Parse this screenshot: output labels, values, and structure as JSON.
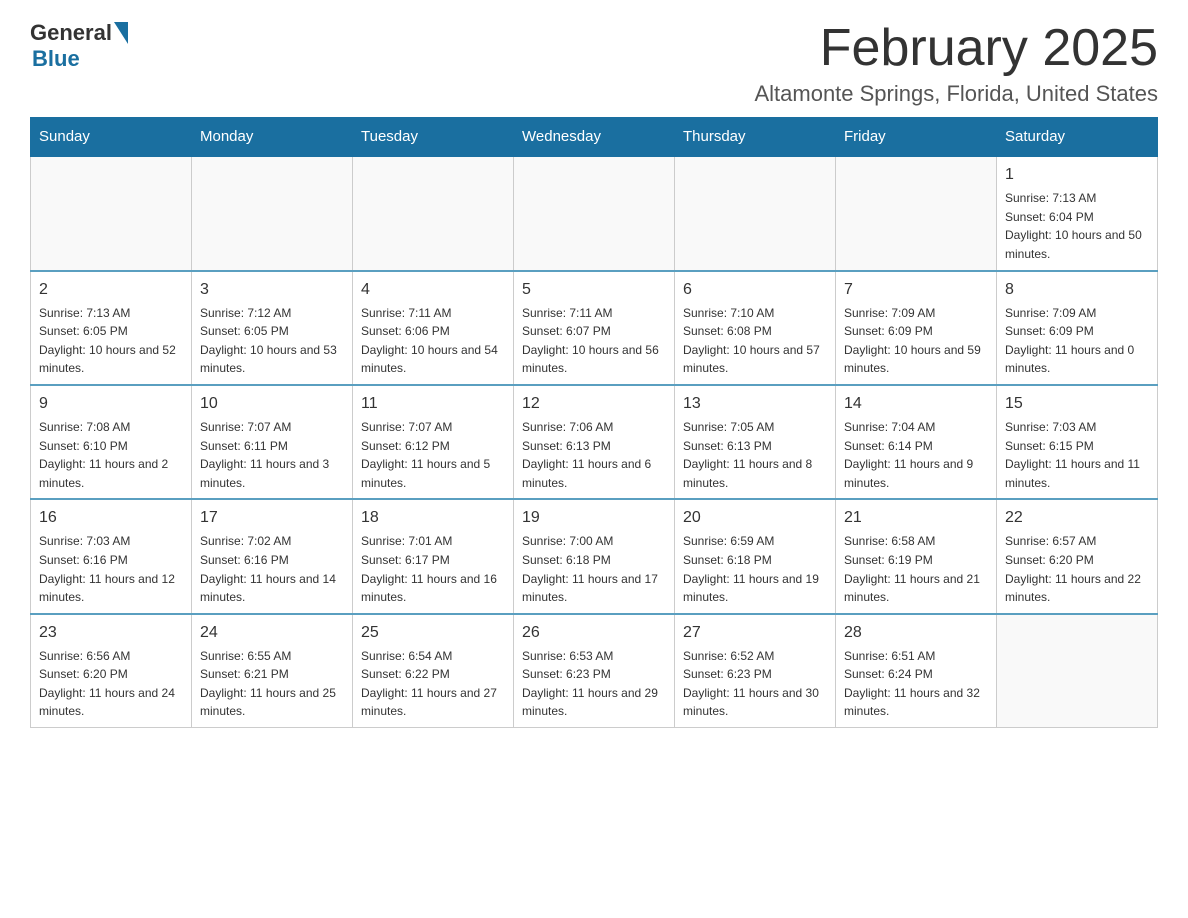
{
  "header": {
    "logo_general": "General",
    "logo_blue": "Blue",
    "month_title": "February 2025",
    "location": "Altamonte Springs, Florida, United States"
  },
  "weekdays": [
    "Sunday",
    "Monday",
    "Tuesday",
    "Wednesday",
    "Thursday",
    "Friday",
    "Saturday"
  ],
  "weeks": [
    [
      {
        "day": "",
        "sunrise": "",
        "sunset": "",
        "daylight": ""
      },
      {
        "day": "",
        "sunrise": "",
        "sunset": "",
        "daylight": ""
      },
      {
        "day": "",
        "sunrise": "",
        "sunset": "",
        "daylight": ""
      },
      {
        "day": "",
        "sunrise": "",
        "sunset": "",
        "daylight": ""
      },
      {
        "day": "",
        "sunrise": "",
        "sunset": "",
        "daylight": ""
      },
      {
        "day": "",
        "sunrise": "",
        "sunset": "",
        "daylight": ""
      },
      {
        "day": "1",
        "sunrise": "Sunrise: 7:13 AM",
        "sunset": "Sunset: 6:04 PM",
        "daylight": "Daylight: 10 hours and 50 minutes."
      }
    ],
    [
      {
        "day": "2",
        "sunrise": "Sunrise: 7:13 AM",
        "sunset": "Sunset: 6:05 PM",
        "daylight": "Daylight: 10 hours and 52 minutes."
      },
      {
        "day": "3",
        "sunrise": "Sunrise: 7:12 AM",
        "sunset": "Sunset: 6:05 PM",
        "daylight": "Daylight: 10 hours and 53 minutes."
      },
      {
        "day": "4",
        "sunrise": "Sunrise: 7:11 AM",
        "sunset": "Sunset: 6:06 PM",
        "daylight": "Daylight: 10 hours and 54 minutes."
      },
      {
        "day": "5",
        "sunrise": "Sunrise: 7:11 AM",
        "sunset": "Sunset: 6:07 PM",
        "daylight": "Daylight: 10 hours and 56 minutes."
      },
      {
        "day": "6",
        "sunrise": "Sunrise: 7:10 AM",
        "sunset": "Sunset: 6:08 PM",
        "daylight": "Daylight: 10 hours and 57 minutes."
      },
      {
        "day": "7",
        "sunrise": "Sunrise: 7:09 AM",
        "sunset": "Sunset: 6:09 PM",
        "daylight": "Daylight: 10 hours and 59 minutes."
      },
      {
        "day": "8",
        "sunrise": "Sunrise: 7:09 AM",
        "sunset": "Sunset: 6:09 PM",
        "daylight": "Daylight: 11 hours and 0 minutes."
      }
    ],
    [
      {
        "day": "9",
        "sunrise": "Sunrise: 7:08 AM",
        "sunset": "Sunset: 6:10 PM",
        "daylight": "Daylight: 11 hours and 2 minutes."
      },
      {
        "day": "10",
        "sunrise": "Sunrise: 7:07 AM",
        "sunset": "Sunset: 6:11 PM",
        "daylight": "Daylight: 11 hours and 3 minutes."
      },
      {
        "day": "11",
        "sunrise": "Sunrise: 7:07 AM",
        "sunset": "Sunset: 6:12 PM",
        "daylight": "Daylight: 11 hours and 5 minutes."
      },
      {
        "day": "12",
        "sunrise": "Sunrise: 7:06 AM",
        "sunset": "Sunset: 6:13 PM",
        "daylight": "Daylight: 11 hours and 6 minutes."
      },
      {
        "day": "13",
        "sunrise": "Sunrise: 7:05 AM",
        "sunset": "Sunset: 6:13 PM",
        "daylight": "Daylight: 11 hours and 8 minutes."
      },
      {
        "day": "14",
        "sunrise": "Sunrise: 7:04 AM",
        "sunset": "Sunset: 6:14 PM",
        "daylight": "Daylight: 11 hours and 9 minutes."
      },
      {
        "day": "15",
        "sunrise": "Sunrise: 7:03 AM",
        "sunset": "Sunset: 6:15 PM",
        "daylight": "Daylight: 11 hours and 11 minutes."
      }
    ],
    [
      {
        "day": "16",
        "sunrise": "Sunrise: 7:03 AM",
        "sunset": "Sunset: 6:16 PM",
        "daylight": "Daylight: 11 hours and 12 minutes."
      },
      {
        "day": "17",
        "sunrise": "Sunrise: 7:02 AM",
        "sunset": "Sunset: 6:16 PM",
        "daylight": "Daylight: 11 hours and 14 minutes."
      },
      {
        "day": "18",
        "sunrise": "Sunrise: 7:01 AM",
        "sunset": "Sunset: 6:17 PM",
        "daylight": "Daylight: 11 hours and 16 minutes."
      },
      {
        "day": "19",
        "sunrise": "Sunrise: 7:00 AM",
        "sunset": "Sunset: 6:18 PM",
        "daylight": "Daylight: 11 hours and 17 minutes."
      },
      {
        "day": "20",
        "sunrise": "Sunrise: 6:59 AM",
        "sunset": "Sunset: 6:18 PM",
        "daylight": "Daylight: 11 hours and 19 minutes."
      },
      {
        "day": "21",
        "sunrise": "Sunrise: 6:58 AM",
        "sunset": "Sunset: 6:19 PM",
        "daylight": "Daylight: 11 hours and 21 minutes."
      },
      {
        "day": "22",
        "sunrise": "Sunrise: 6:57 AM",
        "sunset": "Sunset: 6:20 PM",
        "daylight": "Daylight: 11 hours and 22 minutes."
      }
    ],
    [
      {
        "day": "23",
        "sunrise": "Sunrise: 6:56 AM",
        "sunset": "Sunset: 6:20 PM",
        "daylight": "Daylight: 11 hours and 24 minutes."
      },
      {
        "day": "24",
        "sunrise": "Sunrise: 6:55 AM",
        "sunset": "Sunset: 6:21 PM",
        "daylight": "Daylight: 11 hours and 25 minutes."
      },
      {
        "day": "25",
        "sunrise": "Sunrise: 6:54 AM",
        "sunset": "Sunset: 6:22 PM",
        "daylight": "Daylight: 11 hours and 27 minutes."
      },
      {
        "day": "26",
        "sunrise": "Sunrise: 6:53 AM",
        "sunset": "Sunset: 6:23 PM",
        "daylight": "Daylight: 11 hours and 29 minutes."
      },
      {
        "day": "27",
        "sunrise": "Sunrise: 6:52 AM",
        "sunset": "Sunset: 6:23 PM",
        "daylight": "Daylight: 11 hours and 30 minutes."
      },
      {
        "day": "28",
        "sunrise": "Sunrise: 6:51 AM",
        "sunset": "Sunset: 6:24 PM",
        "daylight": "Daylight: 11 hours and 32 minutes."
      },
      {
        "day": "",
        "sunrise": "",
        "sunset": "",
        "daylight": ""
      }
    ]
  ]
}
